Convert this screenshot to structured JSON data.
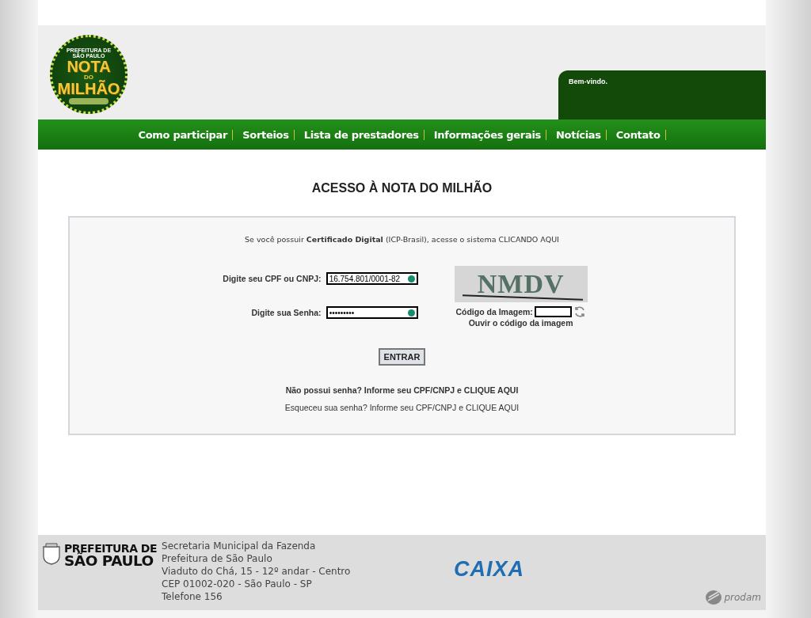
{
  "logo": {
    "top": "PREFEITURA DE SÃO PAULO",
    "line1": "NOTA",
    "line2": "DO",
    "line3": "MILHÃO"
  },
  "welcome": "Bem-vindo.",
  "nav": [
    {
      "label": "Como participar"
    },
    {
      "label": "Sorteios"
    },
    {
      "label": "Lista de prestadores"
    },
    {
      "label": "Informações gerais"
    },
    {
      "label": "Notícias"
    },
    {
      "label": "Contato"
    }
  ],
  "title": "ACESSO À NOTA DO MILHÃO",
  "certificate_notice": "Se você possuir **Certificado Digital** (ICP-Brasil), acesse o sistema CLICANDO AQUI",
  "fields": [
    {
      "label": "Digite seu CPF ou CNPJ:",
      "value": "16.754.801/0001-82"
    },
    {
      "label": "Digite sua Senha:",
      "value": "•••••••••"
    }
  ],
  "captcha": {
    "image_text": "NMDV",
    "label": "Código da Imagem:",
    "audio_link": "Ouvir o código da imagem"
  },
  "submit": "ENTRAR",
  "no_password": "Não possui senha? Informe seu CPF/CNPJ e CLIQUE AQUI",
  "forgot_password": "Esqueceu sua senha? Informe seu CPF/CNPJ e  CLIQUE AQUI",
  "footer": {
    "city_logo": [
      "PREFEITURA DE",
      "SÃO PAULO"
    ],
    "address": [
      "Secretaria Municipal da Fazenda",
      "Prefeitura de São Paulo",
      "Viaduto do Chá, 15 - 12º andar - Centro",
      "CEP 01002-020 - São Paulo - SP",
      "Telefone 156"
    ],
    "bank_logo": "CAIXA",
    "partner_logo": "prodam"
  }
}
